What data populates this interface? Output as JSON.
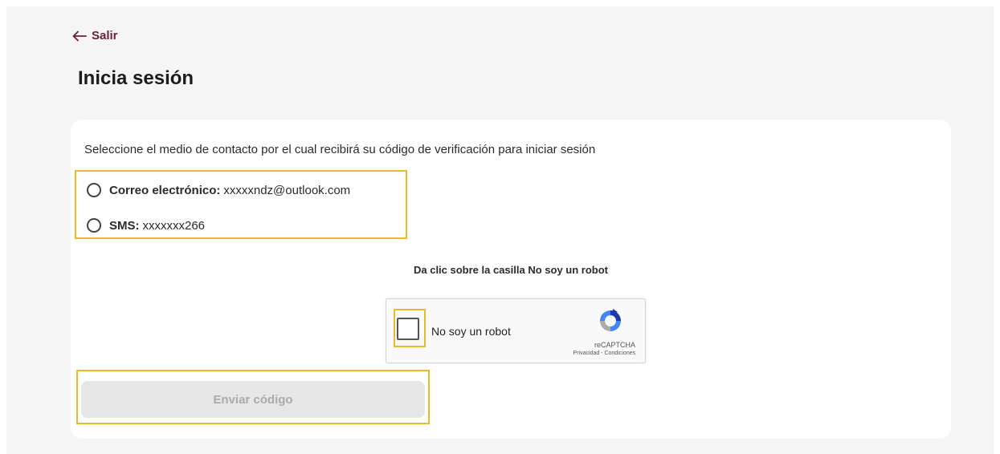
{
  "header": {
    "back_label": "Salir",
    "title": "Inicia sesión"
  },
  "card": {
    "instructions": "Seleccione el medio de contacto por el cual recibirá su código de verificación para iniciar sesión",
    "options": [
      {
        "label": "Correo electrónico:",
        "value": "xxxxxndz@outlook.com",
        "selected": false
      },
      {
        "label": "SMS:",
        "value": "xxxxxxx266",
        "selected": false
      }
    ],
    "captcha_prompt": "Da clic sobre la casilla No soy un robot",
    "recaptcha": {
      "label": "No soy un robot",
      "brand": "reCAPTCHA",
      "privacy": "Privacidad",
      "separator": " - ",
      "terms": "Condiciones",
      "checked": false
    },
    "submit_label": "Enviar código",
    "submit_enabled": false
  },
  "colors": {
    "accent": "#6b1f3a",
    "highlight": "#e9b92e",
    "disabled_bg": "#e6e6e6",
    "disabled_text": "#ababab"
  },
  "icons": {
    "back": "arrow-left-icon",
    "recaptcha_logo": "recaptcha-logo-icon"
  }
}
